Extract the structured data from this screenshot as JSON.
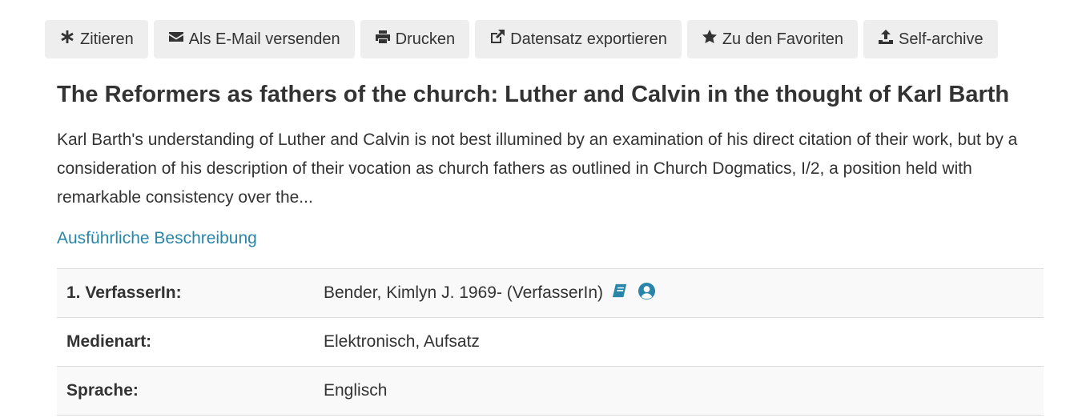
{
  "toolbar": {
    "buttons": [
      {
        "label": "Zitieren",
        "icon": "asterisk-icon"
      },
      {
        "label": "Als E-Mail versenden",
        "icon": "envelope-icon"
      },
      {
        "label": "Drucken",
        "icon": "print-icon"
      },
      {
        "label": "Datensatz exportieren",
        "icon": "external-link-icon"
      },
      {
        "label": "Zu den Favoriten",
        "icon": "star-icon"
      },
      {
        "label": "Self-archive",
        "icon": "upload-icon"
      }
    ]
  },
  "record": {
    "title": "The Reformers as fathers of the church: Luther and Calvin in the thought of Karl Barth",
    "abstract": "Karl Barth's understanding of Luther and Calvin is not best illumined by an examination of his direct citation of their work, but by a consideration of his description of their vocation as church fathers as outlined in Church Dogmatics, I/2, a position held with remarkable consistency over the...",
    "more_link": "Ausführliche Beschreibung"
  },
  "details": {
    "rows": [
      {
        "label": "1. VerfasserIn:",
        "value": "Bender, Kimlyn J. 1969- (VerfasserIn)",
        "icons": [
          "book-icon",
          "user-circle-icon"
        ]
      },
      {
        "label": "Medienart:",
        "value": "Elektronisch, Aufsatz"
      },
      {
        "label": "Sprache:",
        "value": "Englisch"
      }
    ]
  },
  "colors": {
    "link": "#2a86a8",
    "button_bg": "#eeeeee",
    "row_alt_bg": "#f9f9f9",
    "border": "#dddddd",
    "text": "#333333"
  }
}
